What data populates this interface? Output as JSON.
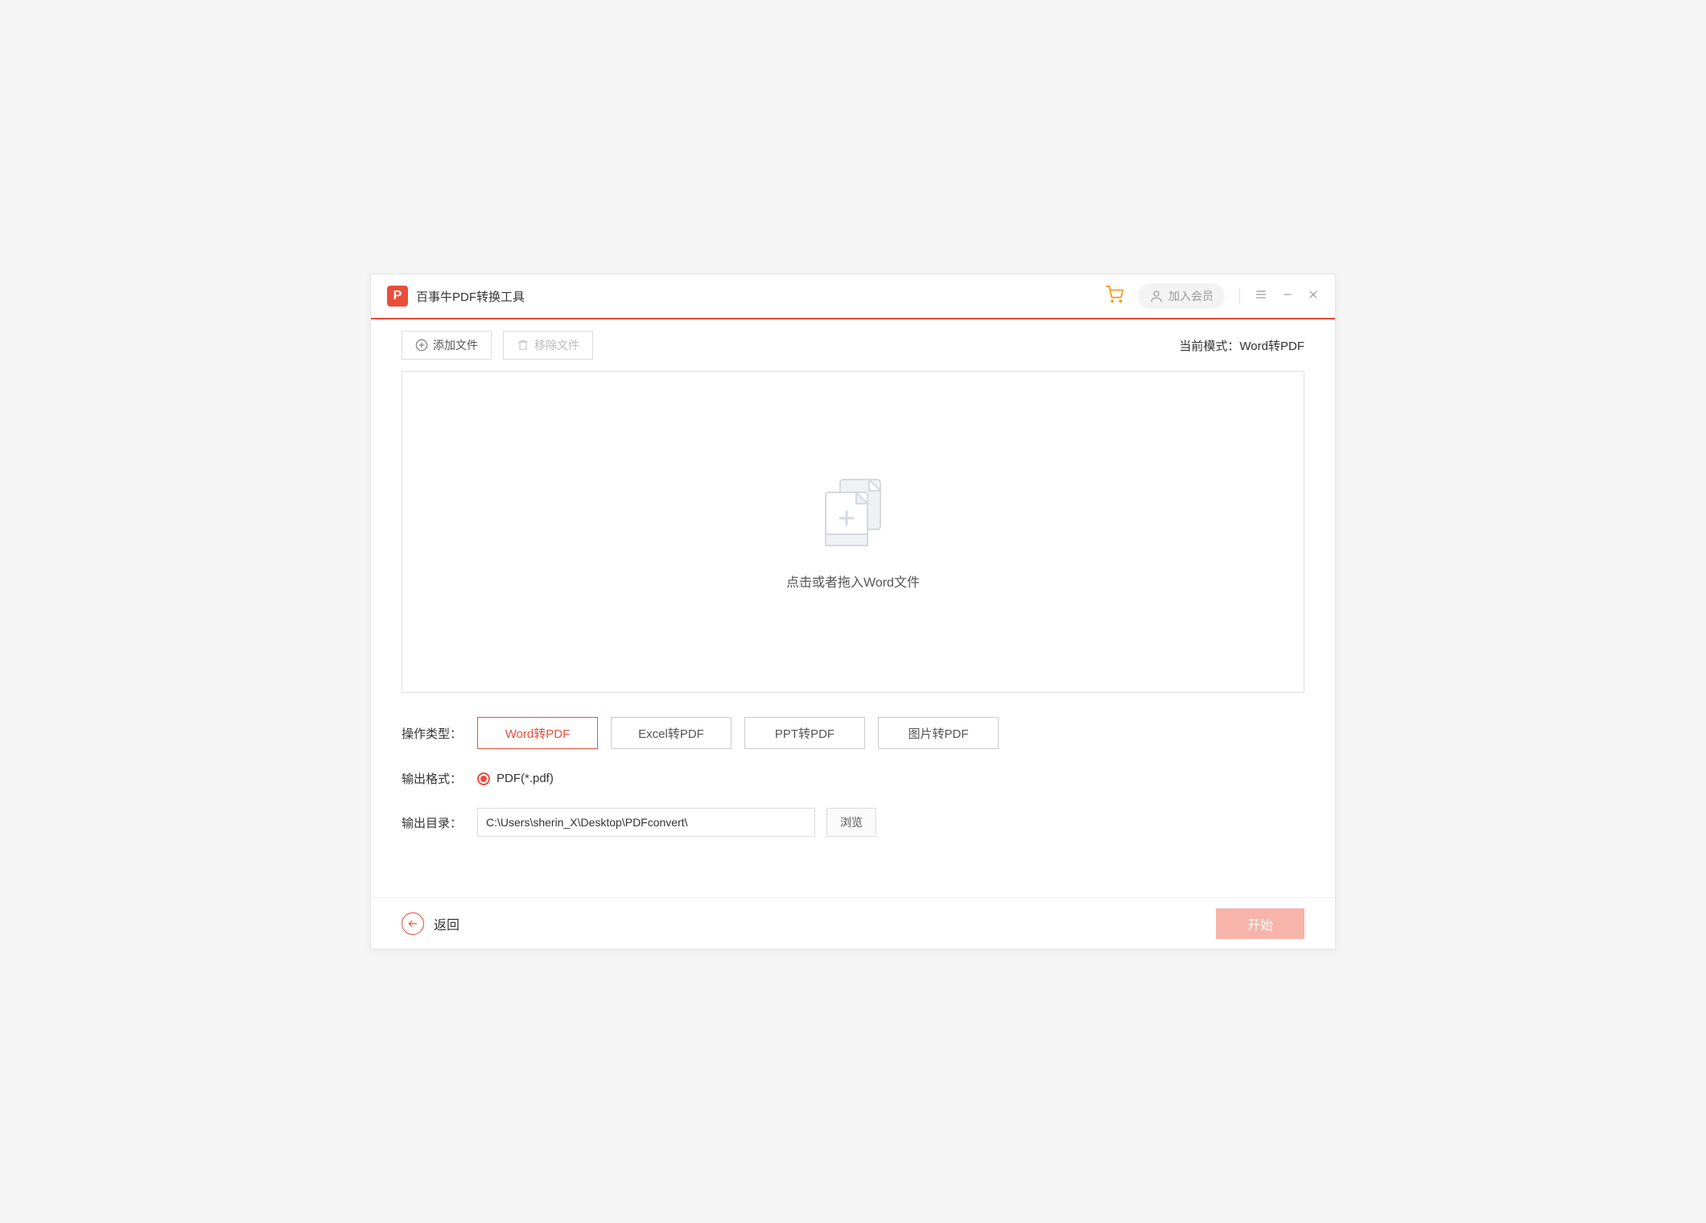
{
  "header": {
    "title": "百事牛PDF转换工具",
    "member_label": "加入会员"
  },
  "toolbar": {
    "add_file_label": "添加文件",
    "remove_file_label": "移除文件",
    "mode_prefix": "当前模式：",
    "mode_value": "Word转PDF"
  },
  "dropzone": {
    "hint": "点击或者拖入Word文件"
  },
  "options": {
    "op_type_label": "操作类型：",
    "tabs": [
      {
        "label": "Word转PDF",
        "active": true
      },
      {
        "label": "Excel转PDF",
        "active": false
      },
      {
        "label": "PPT转PDF",
        "active": false
      },
      {
        "label": "图片转PDF",
        "active": false
      }
    ],
    "output_format_label": "输出格式：",
    "output_format_value": "PDF(*.pdf)",
    "output_dir_label": "输出目录：",
    "output_dir_value": "C:\\Users\\sherin_X\\Desktop\\PDFconvert\\",
    "browse_label": "浏览"
  },
  "footer": {
    "back_label": "返回",
    "start_label": "开始"
  }
}
